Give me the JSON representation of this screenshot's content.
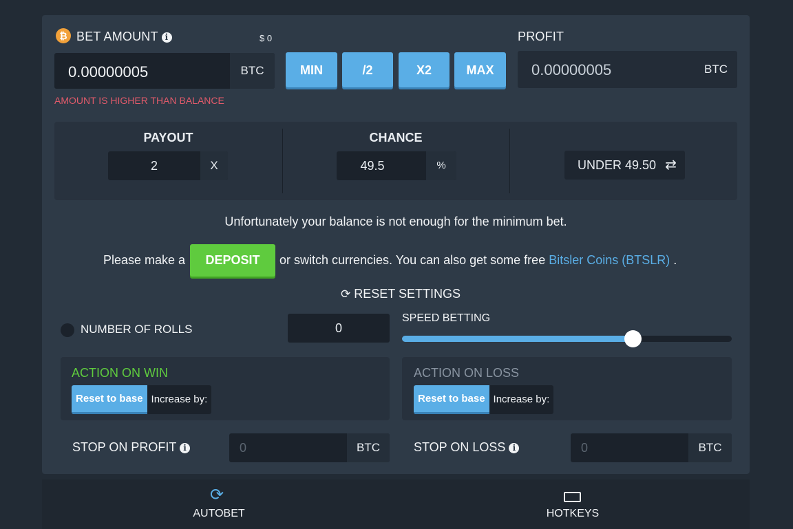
{
  "bet": {
    "title": "BET AMOUNT",
    "usd": "$ 0",
    "value": "0.00000005",
    "unit": "BTC",
    "error": "AMOUNT IS HIGHER THAN BALANCE",
    "coin_symbol": "₿"
  },
  "quick_buttons": [
    "MIN",
    "/2",
    "X2",
    "MAX"
  ],
  "profit": {
    "title": "PROFIT",
    "value": "0.00000005",
    "unit": "BTC"
  },
  "payout": {
    "title": "PAYOUT",
    "value": "2",
    "unit": "X"
  },
  "chance": {
    "title": "CHANCE",
    "value": "49.5",
    "unit": "%"
  },
  "under_label": "UNDER 49.50",
  "messages": {
    "balance": "Unfortunately your balance is not enough for the minimum bet.",
    "please": "Please make a",
    "deposit": "DEPOSIT",
    "switch": "or switch currencies. You can also get some free",
    "coins_link": "Bitsler Coins (BTSLR)",
    "end": "."
  },
  "reset_settings": "RESET SETTINGS",
  "rolls": {
    "label": "NUMBER OF ROLLS",
    "value": "0"
  },
  "speed": {
    "label": "SPEED BETTING",
    "level_percent": 70
  },
  "action_win": {
    "title": "ACTION ON WIN",
    "reset": "Reset to base",
    "increase": "Increase by:"
  },
  "action_loss": {
    "title": "ACTION ON LOSS",
    "reset": "Reset to base",
    "increase": "Increase by:"
  },
  "stop_profit": {
    "label": "STOP ON PROFIT",
    "placeholder": "0",
    "unit": "BTC"
  },
  "stop_loss": {
    "label": "STOP ON LOSS",
    "placeholder": "0",
    "unit": "BTC"
  },
  "bottom_tabs": {
    "autobet": "AUTOBET",
    "hotkeys": "HOTKEYS"
  },
  "colors": {
    "accent": "#5aaee6",
    "deposit": "#5fcb3e",
    "error": "#e05a6a",
    "win": "#5fcb3e"
  }
}
